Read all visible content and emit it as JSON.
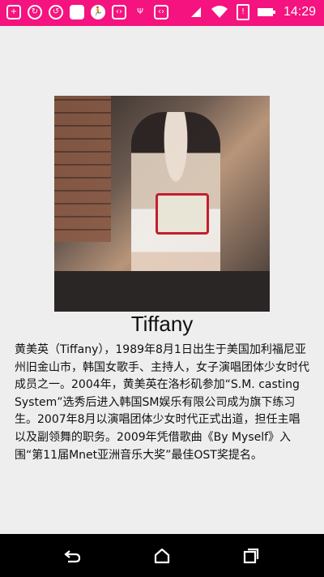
{
  "status_bar": {
    "time": "14:29",
    "icons": [
      "add-box-icon",
      "sync-icon",
      "sync-alt-icon",
      "blank-notification-icon",
      "running-man-icon",
      "code-icon",
      "usb-icon",
      "code-icon",
      "triangle-icon",
      "wifi-icon",
      "no-sim-icon",
      "battery-icon"
    ]
  },
  "profile": {
    "name": "Tiffany",
    "bio": "黄美英（Tiffany），1989年8月1日出生于美国加利福尼亚州旧金山市，韩国女歌手、主持人，女子演唱团体少女时代成员之一。2004年，黄美英在洛杉矶参加“S.M. casting System”选秀后进入韩国SM娱乐有限公司成为旗下练习生。2007年8月以演唱团体少女时代正式出道，担任主唱以及副领舞的职务。2009年凭借歌曲《By Myself》入围“第11届Mnet亚洲音乐大奖”最佳OST奖提名。"
  },
  "nav_bar": {
    "buttons": [
      "back-icon",
      "home-icon",
      "recents-icon"
    ]
  },
  "colors": {
    "status_bar": "#f5137f",
    "background": "#eeeeee",
    "nav_bar": "#000000"
  }
}
